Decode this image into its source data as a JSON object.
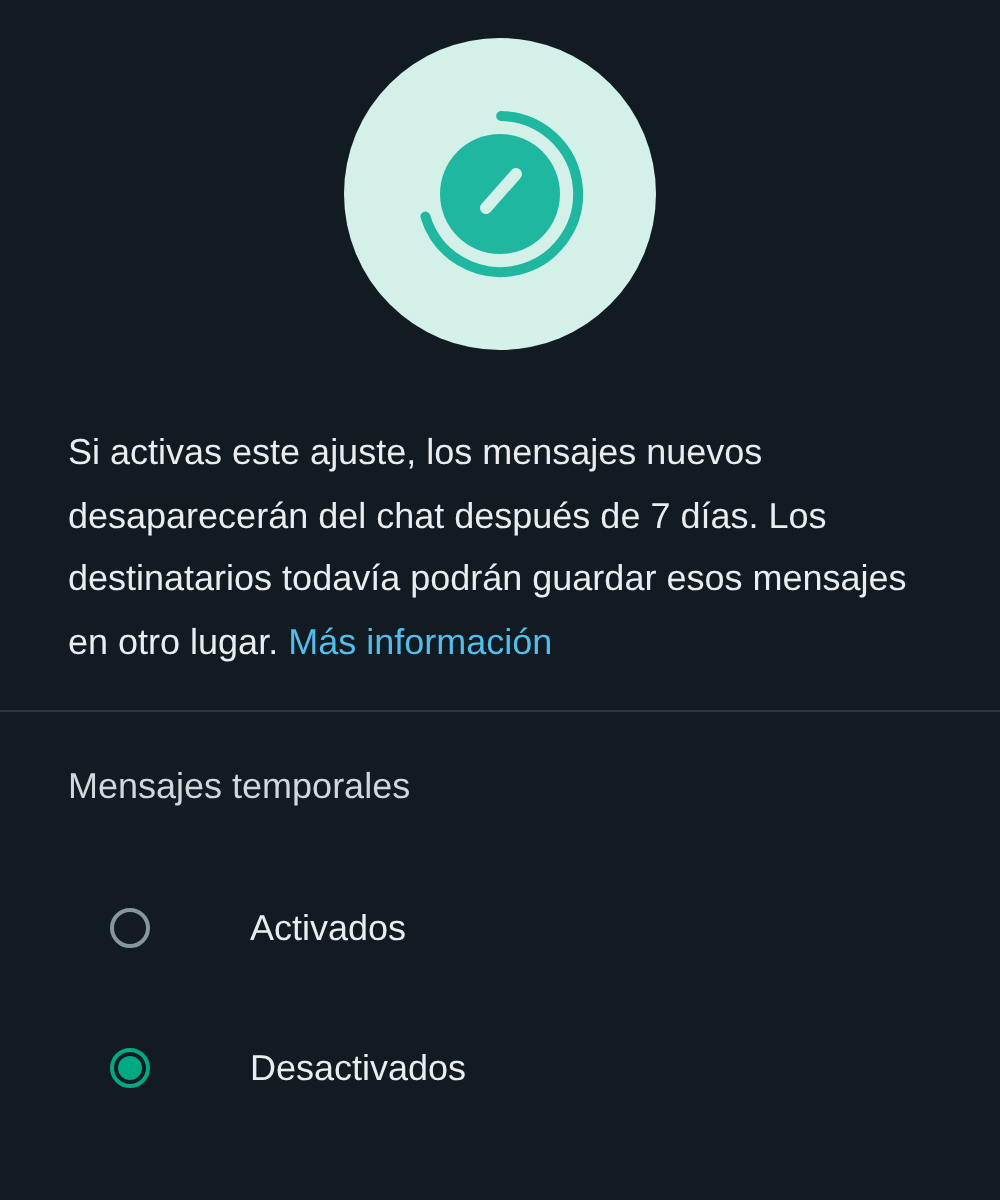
{
  "description": {
    "text": "Si activas este ajuste, los mensajes nuevos desaparecerán del chat después de 7 días. Los destinatarios todavía podrán guardar esos mensajes en otro lugar.",
    "link": "Más información"
  },
  "section_title": "Mensajes temporales",
  "options": [
    {
      "label": "Activados",
      "selected": false
    },
    {
      "label": "Desactivados",
      "selected": true
    }
  ]
}
